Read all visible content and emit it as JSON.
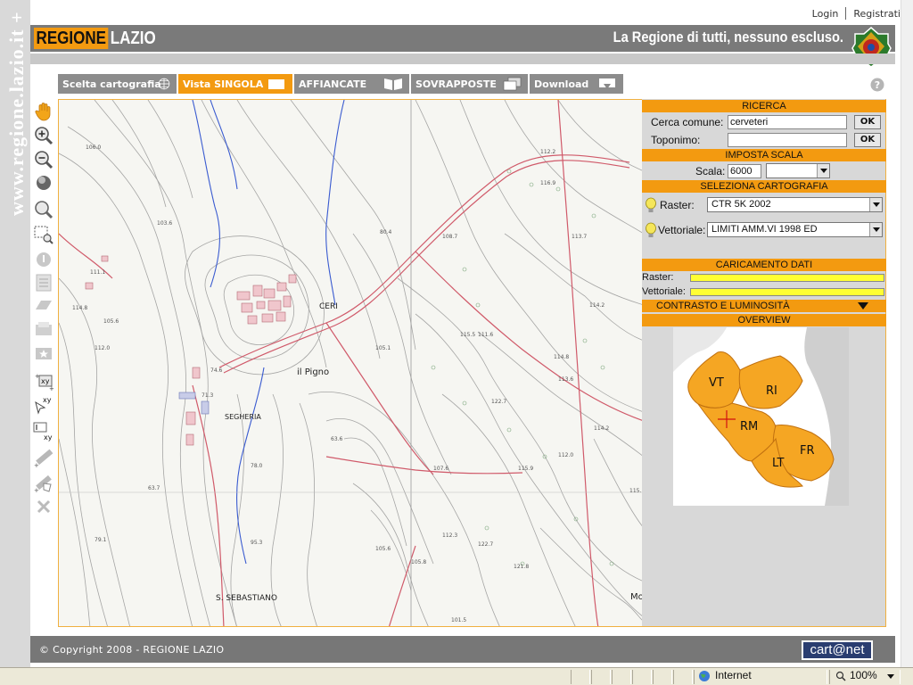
{
  "side_watermark": "www.regione.lazio.it +",
  "top_links": {
    "login": "Login",
    "register": "Registrati"
  },
  "header": {
    "logo_part1": "REGIONE",
    "logo_part2": "LAZIO",
    "slogan": "La Regione di tutti, nessuno escluso."
  },
  "tabs": [
    {
      "label": "Scelta cartografia",
      "active": false
    },
    {
      "label": "Vista SINGOLA",
      "active": true
    },
    {
      "label": "AFFIANCATE",
      "active": false
    },
    {
      "label": "SOVRAPPOSTE",
      "active": false
    },
    {
      "label": "Download",
      "active": false
    }
  ],
  "panel": {
    "ricerca": {
      "title": "RICERCA",
      "comune_label": "Cerca comune:",
      "comune_value": "cerveteri",
      "toponimo_label": "Toponimo:",
      "toponimo_value": "",
      "ok": "OK"
    },
    "scala": {
      "title": "IMPOSTA SCALA",
      "label": "Scala:",
      "value": "6000"
    },
    "cartografia": {
      "title": "SELEZIONA CARTOGRAFIA",
      "raster_label": "Raster:",
      "raster_value": "CTR  5K 2002",
      "vettoriale_label": "Vettoriale:",
      "vettoriale_value": "LIMITI AMM.VI 1998 ED"
    },
    "caricamento": {
      "title": "CARICAMENTO DATI",
      "raster_label": "Raster:",
      "vettoriale_label": "Vettoriale:",
      "raster_progress": 1.0,
      "vettoriale_progress": 1.0
    },
    "contrasto": {
      "title": "CONTRASTO E LUMINOSITÀ"
    },
    "overview": {
      "title": "OVERVIEW",
      "provinces": [
        "VT",
        "RI",
        "RM",
        "FR",
        "LT"
      ]
    }
  },
  "map_labels": {
    "town1": "CERI",
    "town2": "il Pigno",
    "town3": "SEGHERIA",
    "town4": "S. SEBASTIANO",
    "edge": "Mo"
  },
  "footer": {
    "copyright": "© Copyright 2008 - REGIONE LAZIO",
    "brand": "cart@net"
  },
  "statusbar": {
    "zone": "Internet",
    "zoom": "100%"
  },
  "colors": {
    "accent": "#f39a10",
    "header_gray": "#7a7a7a",
    "region_orange": "#f5a623"
  }
}
